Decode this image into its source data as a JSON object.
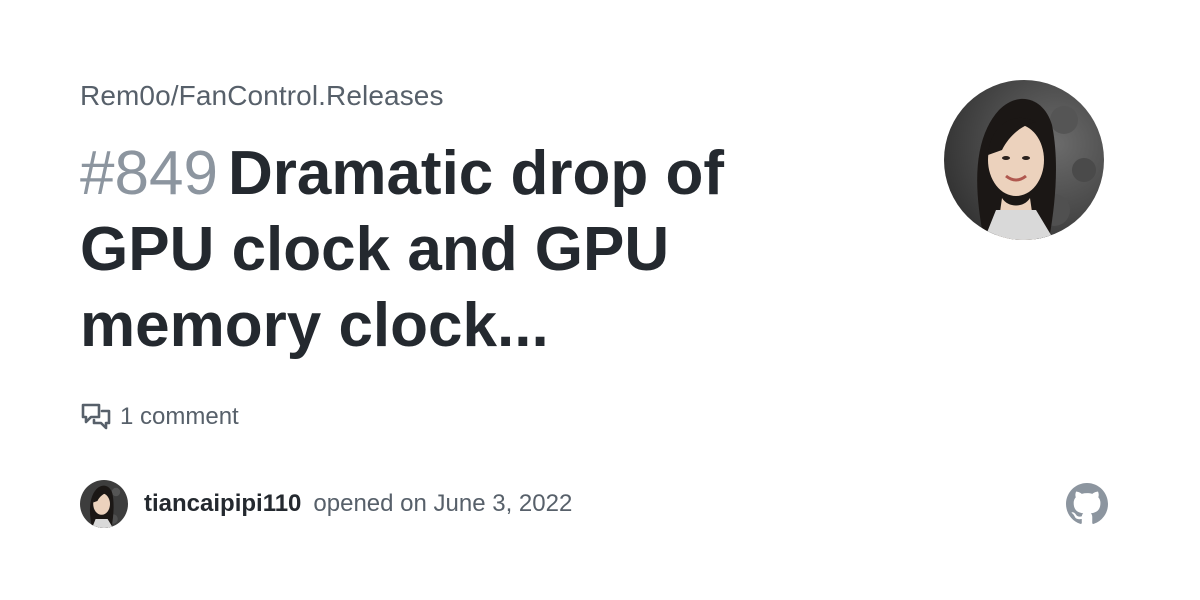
{
  "repo": "Rem0o/FanControl.Releases",
  "issue": {
    "number": "#849",
    "title": "Dramatic drop of GPU clock and GPU memory clock..."
  },
  "comments": {
    "label": "1 comment"
  },
  "author": {
    "username": "tiancaipipi110",
    "meta": "opened on June 3, 2022"
  },
  "icons": {
    "comment": "comment-discussion-icon",
    "brand": "github-logo-icon"
  },
  "colors": {
    "text_primary": "#24292f",
    "text_muted": "#57606a",
    "issue_number": "#8c959f",
    "github_logo": "#8c959f"
  }
}
